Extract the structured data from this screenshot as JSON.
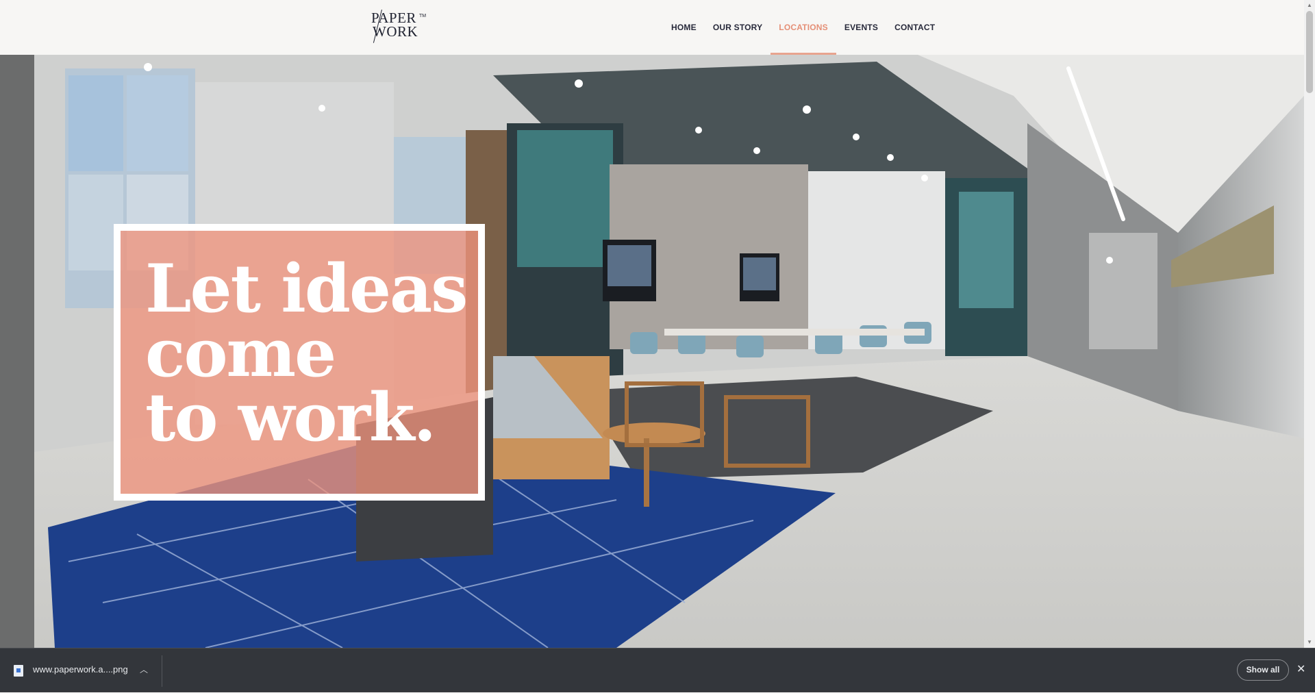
{
  "logo": {
    "line1": "PAPER",
    "line2": "WORK",
    "tm": "TM"
  },
  "nav": {
    "items": [
      {
        "label": "HOME",
        "active": false
      },
      {
        "label": "OUR STORY",
        "active": false
      },
      {
        "label": "LOCATIONS",
        "active": true
      },
      {
        "label": "EVENTS",
        "active": false
      },
      {
        "label": "CONTACT",
        "active": false
      }
    ]
  },
  "hero": {
    "tagline": "Let ideas\ncome\nto work."
  },
  "download_bar": {
    "file_name": "www.paperwork.a....png",
    "show_all_label": "Show all"
  },
  "colors": {
    "accent": "#e58f76",
    "nav_text": "#27293a",
    "header_bg": "#f7f6f4",
    "tagline_overlay": "#ef947c",
    "download_bar_bg": "#33363b"
  }
}
